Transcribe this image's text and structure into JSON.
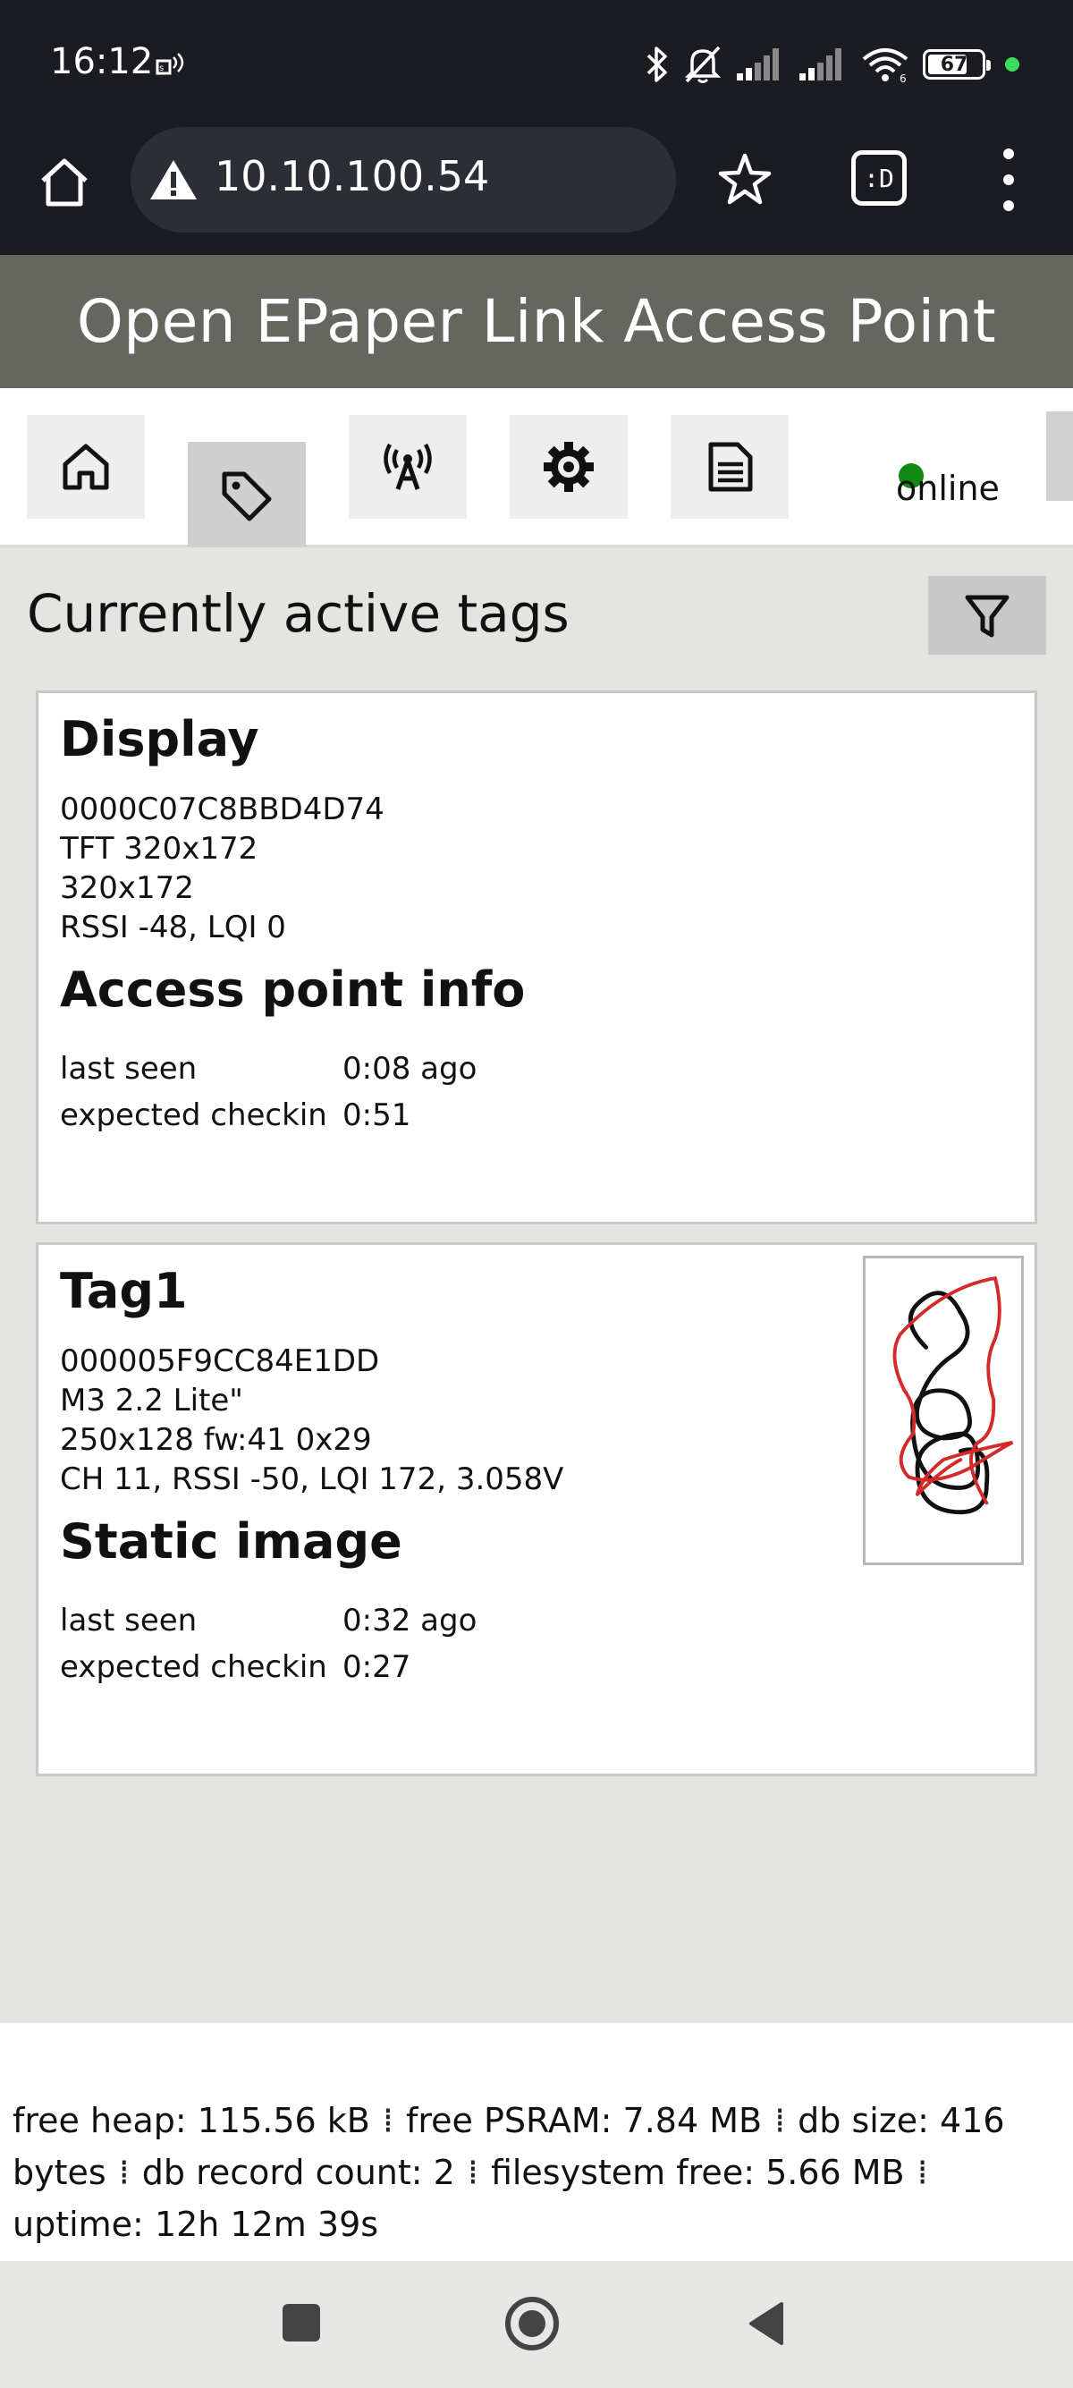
{
  "status_bar": {
    "time": "16:12",
    "battery_level": "67",
    "icons": [
      "sim-icon",
      "bluetooth-icon",
      "mute-icon",
      "signal-icon",
      "signal-icon",
      "wifi-icon",
      "battery-icon"
    ]
  },
  "browser": {
    "url": "10.10.100.54",
    "tabs_label": ":D"
  },
  "header": {
    "title": "Open EPaper Link Access Point"
  },
  "nav": {
    "items": [
      {
        "icon": "home-icon"
      },
      {
        "icon": "tag-icon",
        "active": true
      },
      {
        "icon": "antenna-icon"
      },
      {
        "icon": "gear-icon"
      },
      {
        "icon": "log-icon"
      }
    ],
    "status": "online",
    "status_color": "#118811"
  },
  "main": {
    "title": "Currently active tags",
    "tags": [
      {
        "name": "Display",
        "lines": [
          "0000C07C8BBD4D74",
          "TFT 320x172",
          "320x172",
          "RSSI -48, LQI 0"
        ],
        "content_type": "Access point info",
        "last_seen_label": "last seen",
        "last_seen": "0:08 ago",
        "checkin_label": "expected checkin",
        "checkin": "0:51"
      },
      {
        "name": "Tag1",
        "lines": [
          "000005F9CC84E1DD",
          "M3 2.2 Lite\"",
          "250x128 fw:41 0x29",
          "CH 11, RSSI -50, LQI 172, 3.058V"
        ],
        "content_type": "Static image",
        "last_seen_label": "last seen",
        "last_seen": "0:32 ago",
        "checkin_label": "expected checkin",
        "checkin": "0:27"
      }
    ]
  },
  "footer": {
    "free_heap": "free heap: 115.56 kB",
    "free_psram": "free PSRAM: 7.84 MB",
    "db_size": "db size: 416 bytes",
    "db_records": "db record count: 2",
    "fs_free": "filesystem free: 5.66 MB",
    "uptime": "uptime: 12h 12m 39s"
  }
}
